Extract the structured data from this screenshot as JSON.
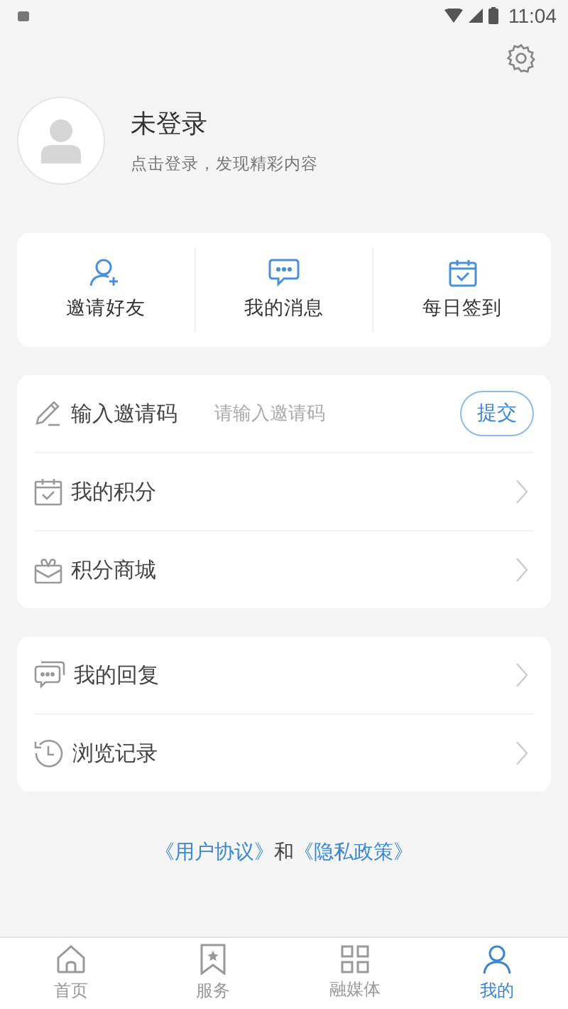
{
  "status_bar": {
    "time": "11:04"
  },
  "profile": {
    "name": "未登录",
    "subtitle": "点击登录，发现精彩内容"
  },
  "quick_actions": [
    {
      "label": "邀请好友"
    },
    {
      "label": "我的消息"
    },
    {
      "label": "每日签到"
    }
  ],
  "invite": {
    "label": "输入邀请码",
    "placeholder": "请输入邀请码",
    "button": "提交"
  },
  "menu_groups": [
    [
      {
        "label": "我的积分"
      },
      {
        "label": "积分商城"
      }
    ],
    [
      {
        "label": "我的回复"
      },
      {
        "label": "浏览记录"
      }
    ]
  ],
  "footer": {
    "links": [
      "《用户协议》",
      "《隐私政策》"
    ],
    "joiner": "和"
  },
  "bottom_nav": [
    {
      "label": "首页",
      "selected": false
    },
    {
      "label": "服务",
      "selected": false
    },
    {
      "label": "融媒体",
      "selected": false
    },
    {
      "label": "我的",
      "selected": true
    }
  ]
}
